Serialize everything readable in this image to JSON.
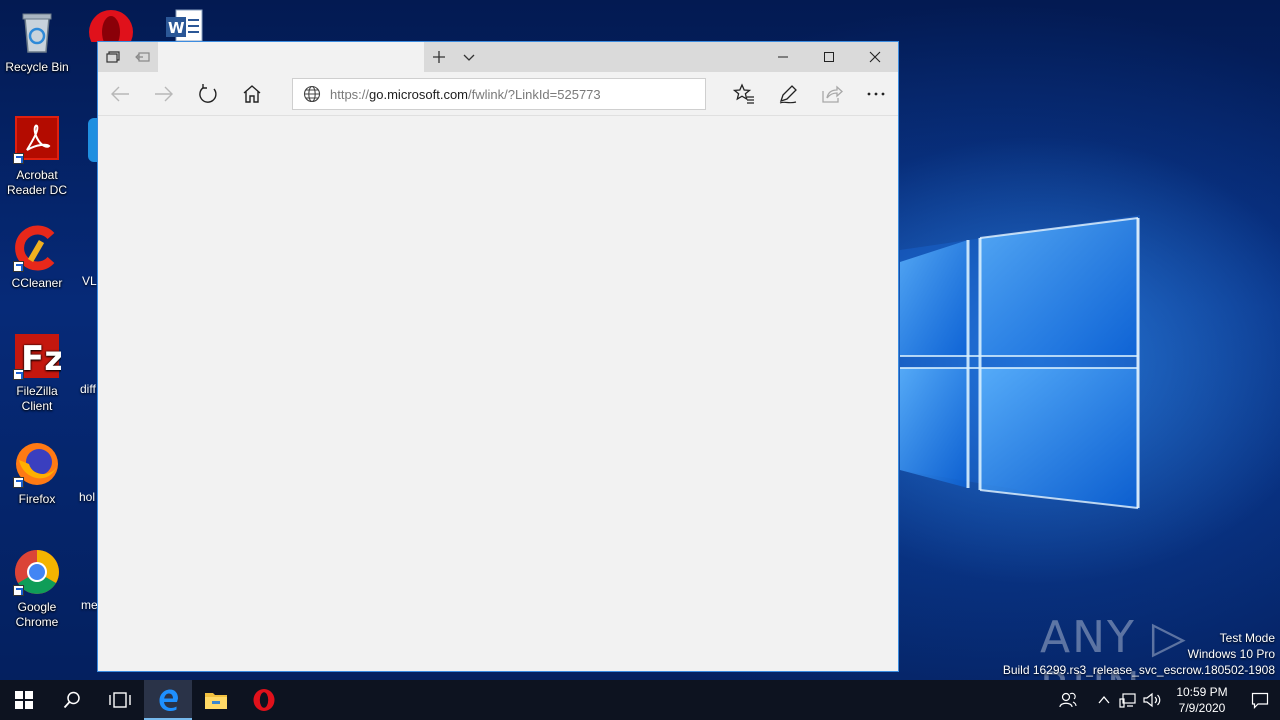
{
  "desktop": {
    "icons": [
      {
        "label": "Recycle Bin"
      },
      {
        "label": "Acrobat Reader DC"
      },
      {
        "label": "CCleaner"
      },
      {
        "label": "FileZilla Client"
      },
      {
        "label": "Firefox"
      },
      {
        "label": "Google Chrome"
      }
    ],
    "partial_labels": [
      "VL",
      "diff",
      "hol",
      "me"
    ],
    "watermark": "ANY ▷ RUN",
    "status": {
      "line1": "Test Mode",
      "line2": "Windows 10 Pro",
      "line3": "Build 16299.rs3_release_svc_escrow.180502-1908"
    }
  },
  "browser": {
    "address_url_scheme": "https://",
    "address_url_host": "go.microsoft.com",
    "address_url_path": "/fwlink/?LinkId=525773",
    "titlebar_buttons": [
      "tab-preview",
      "set-tabs-aside",
      "new-tab",
      "tab-list"
    ],
    "window_controls": [
      "minimize",
      "maximize",
      "close"
    ],
    "nav_buttons": [
      "back",
      "forward",
      "refresh",
      "home"
    ],
    "toolbar_buttons": [
      "favorites",
      "web-note",
      "share",
      "more"
    ]
  },
  "taskbar": {
    "apps": [
      "start",
      "search",
      "task-view",
      "edge",
      "file-explorer",
      "opera"
    ],
    "active_app": "edge",
    "clock_time": "10:59 PM",
    "clock_date": "7/9/2020"
  },
  "colors": {
    "window_border": "#3c8ce0",
    "taskbar": "#0d1320",
    "accent": "#76b9ed"
  }
}
